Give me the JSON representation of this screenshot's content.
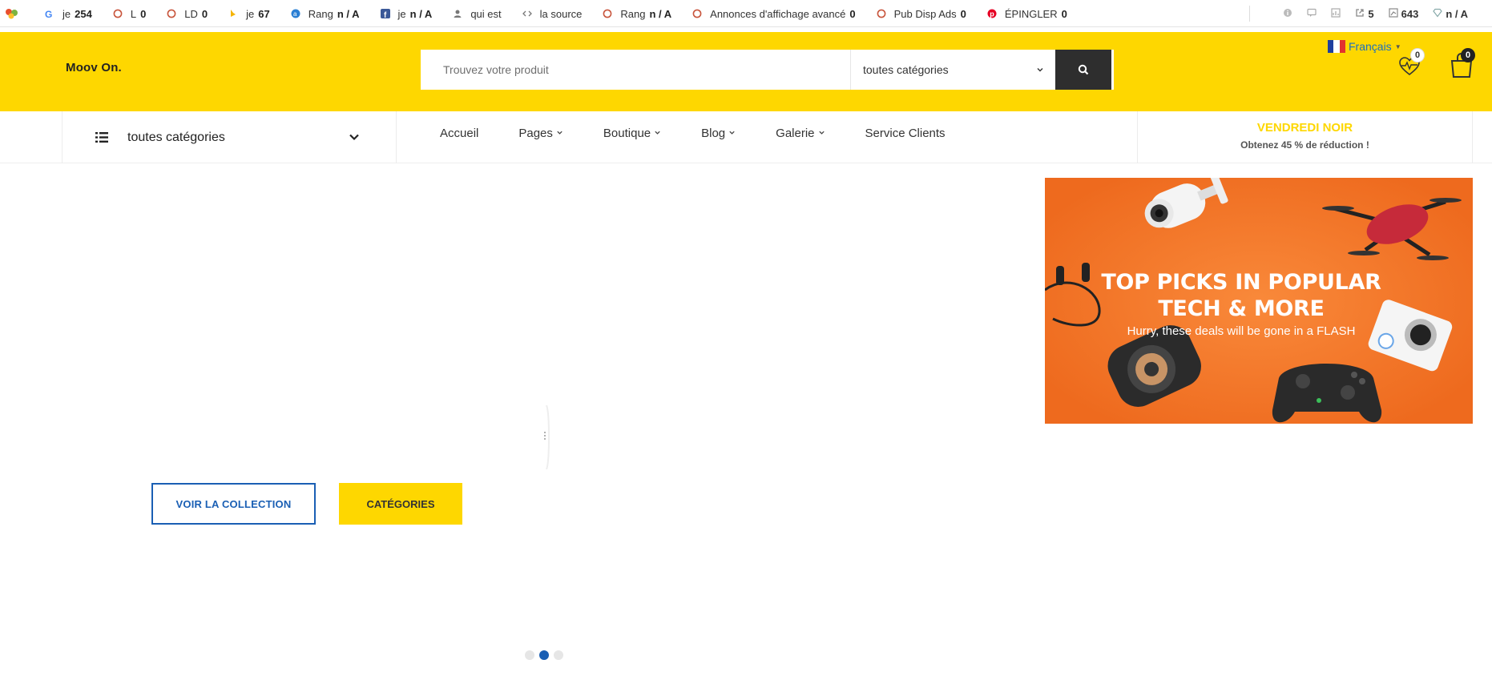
{
  "seo_toolbar": {
    "items": [
      {
        "icon": "google-icon",
        "label": "je",
        "value": "254"
      },
      {
        "icon": "circle-icon",
        "label": "L",
        "value": "0"
      },
      {
        "icon": "circle-icon",
        "label": "LD",
        "value": "0"
      },
      {
        "icon": "bing-icon",
        "label": "je",
        "value": "67"
      },
      {
        "icon": "alexa-icon",
        "label": "Rang",
        "value": "n / A"
      },
      {
        "icon": "facebook-icon",
        "label": "je",
        "value": "n / A"
      },
      {
        "icon": "user-icon",
        "label": "qui est",
        "value": ""
      },
      {
        "icon": "code-icon",
        "label": "la source",
        "value": ""
      },
      {
        "icon": "circle-icon",
        "label": "Rang",
        "value": "n / A"
      },
      {
        "icon": "circle-icon",
        "label": "Annonces d'affichage avancé",
        "value": "0"
      },
      {
        "icon": "circle-icon",
        "label": "Pub Disp Ads",
        "value": "0"
      },
      {
        "icon": "pinterest-icon",
        "label": "ÉPINGLER",
        "value": "0"
      }
    ],
    "right": [
      {
        "icon": "info-icon",
        "value": ""
      },
      {
        "icon": "comment-icon",
        "value": ""
      },
      {
        "icon": "chart-icon",
        "value": ""
      },
      {
        "icon": "external-link-icon",
        "value": "5"
      },
      {
        "icon": "bar-chart-icon",
        "value": "643"
      },
      {
        "icon": "diamond-icon",
        "value": "n / A"
      }
    ]
  },
  "header": {
    "brand": "Moov On.",
    "search_placeholder": "Trouvez votre produit",
    "search_category": "toutes catégories",
    "language": "Français",
    "wishlist_count": "0",
    "cart_count": "0",
    "colors": {
      "brand_yellow": "#fed700",
      "accent_blue": "#1a5fb4",
      "dark": "#2e2e2e"
    }
  },
  "nav": {
    "all_categories": "toutes catégories",
    "menu": [
      {
        "label": "Accueil",
        "has_dropdown": false
      },
      {
        "label": "Pages",
        "has_dropdown": true
      },
      {
        "label": "Boutique",
        "has_dropdown": true
      },
      {
        "label": "Blog",
        "has_dropdown": true
      },
      {
        "label": "Galerie",
        "has_dropdown": true
      },
      {
        "label": "Service Clients",
        "has_dropdown": false
      }
    ],
    "promo_title": "VENDREDI NOIR",
    "promo_text": "Obtenez 45 % de réduction !"
  },
  "hero": {
    "btn_collection": "VOIR LA COLLECTION",
    "btn_categories": "CATÉGORIES",
    "slides": 3,
    "active_slide": 2
  },
  "banner": {
    "title_line1": "TOP PICKS IN POPULAR",
    "title_line2": "TECH & MORE",
    "subtitle": "Hurry, these deals will be gone in a FLASH"
  }
}
